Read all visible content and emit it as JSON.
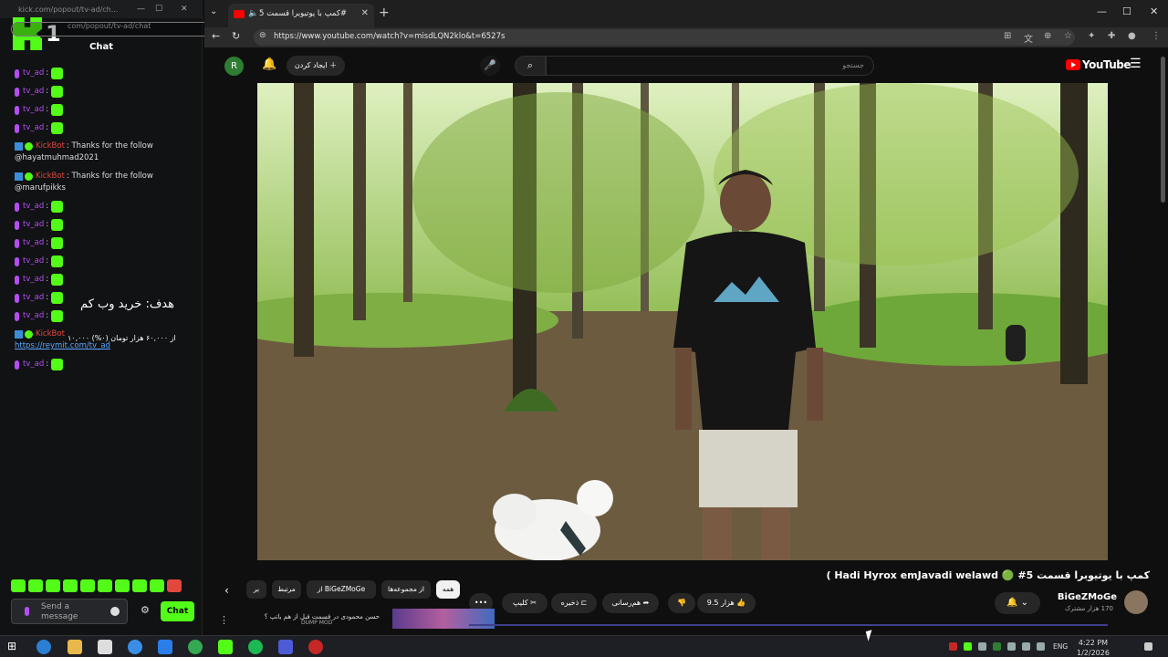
{
  "kick": {
    "url": "kick.com/popout/tv-ad/ch...",
    "url_full": "com/popout/tv-ad/chat",
    "logo_number": "1",
    "chat_tab": "Chat",
    "messages": [
      {
        "type": "emote",
        "user": "tv_ad"
      },
      {
        "type": "emote",
        "user": "tv_ad"
      },
      {
        "type": "emote",
        "user": "tv_ad"
      },
      {
        "type": "emote",
        "user": "tv_ad"
      },
      {
        "type": "bot",
        "user": "KickBot",
        "text": "Thanks for the follow",
        "sub": "@hayatmuhmad2021"
      },
      {
        "type": "bot",
        "user": "KickBot",
        "text": "Thanks for the follow",
        "sub": "@marufpikks"
      },
      {
        "type": "emote",
        "user": "tv_ad"
      },
      {
        "type": "emote",
        "user": "tv_ad"
      },
      {
        "type": "emote",
        "user": "tv_ad"
      },
      {
        "type": "emote",
        "user": "tv_ad"
      },
      {
        "type": "emote",
        "user": "tv_ad"
      },
      {
        "type": "emote",
        "user": "tv_ad"
      },
      {
        "type": "emote",
        "user": "tv_ad"
      },
      {
        "type": "link",
        "user": "KickBot",
        "link": "https://reymit.com/tv_ad"
      },
      {
        "type": "emote",
        "user": "tv_ad"
      }
    ],
    "goal": {
      "title": "هدف: خرید وب کم",
      "percent": "%۰",
      "amount": "۱۰,۰۰۰ از ۶۰,۰۰۰ هزار تومان (۰%)"
    },
    "send_placeholder": "Send a message",
    "chat_button": "Chat"
  },
  "browser": {
    "tab_title": "کمپ با یوتیوبرا قسمت 5#",
    "address": "https://www.youtube.com/watch?v=misdLQN2klo&t=6527s"
  },
  "youtube": {
    "avatar_letter": "R",
    "create_label": "ایجاد کردن",
    "search_placeholder": "جستجو",
    "logo_text": "YouTube",
    "video_title": "کمپ با یوتیوبرا قسمت 5# 🟢 Hadi Hyrox emJavadi welawd )",
    "channel_name": "BiGeZMoGe",
    "channel_subs": "170 هزار مشترک",
    "like_count": "9.5 هزار",
    "share_label": "هم‌رسانی",
    "save_label": "ذخیره",
    "clip_label": "کلیپ",
    "more_label": "•••",
    "chips": [
      "همه",
      "از مجموعه‌ها",
      "از BiGeZMoGe",
      "مرتبط",
      "بر"
    ],
    "rec_title": "حسن محمودی در قسمت قبل از هم باتپ ؟",
    "rec_thumb_text": "DUMP MOD"
  },
  "taskbar": {
    "time": "4:22 PM",
    "date": "1/2/2026",
    "lang": "ENG"
  },
  "colors": {
    "kick_green": "#53fc18",
    "yt_red": "#ff0000",
    "user_purple": "#b24ff2"
  }
}
